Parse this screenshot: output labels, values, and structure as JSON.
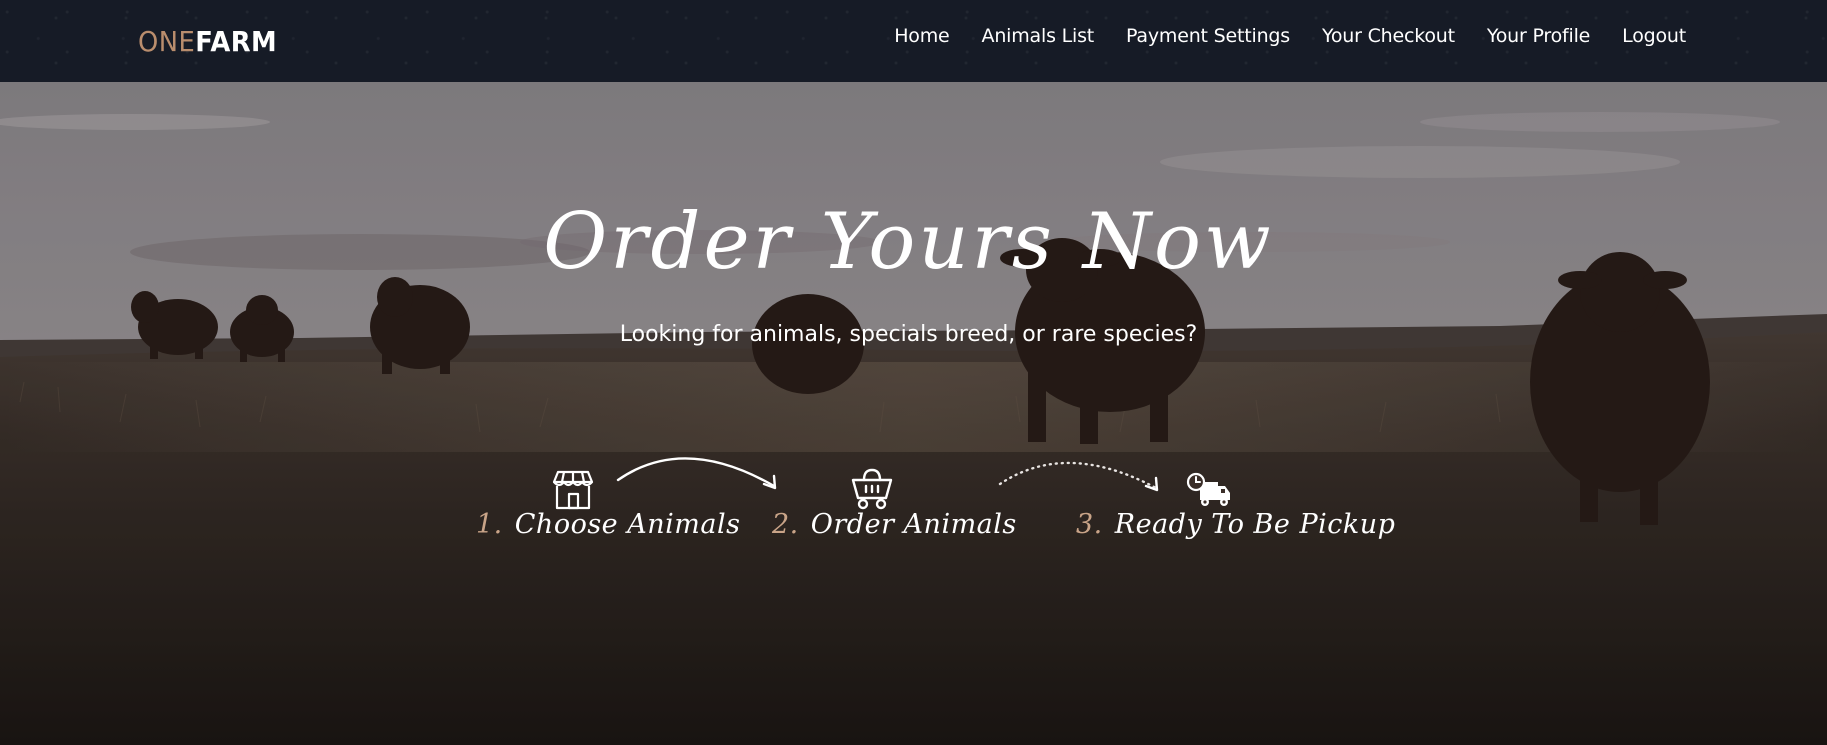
{
  "header": {
    "logo_part1": "ONE",
    "logo_part2": "FARM",
    "nav": [
      "Home",
      "Animals List",
      "Payment Settings",
      "Your Checkout",
      "Your Profile",
      "Logout"
    ]
  },
  "hero": {
    "title": "Order Yours Now",
    "subtitle": "Looking for animals, specials breed, or rare species?",
    "steps": [
      {
        "number": "1.",
        "label": "Choose Animals",
        "icon": "shop-icon"
      },
      {
        "number": "2.",
        "label": "Order Animals",
        "icon": "cart-icon"
      },
      {
        "number": "3.",
        "label": "Ready To Be Pickup",
        "icon": "delivery-truck-icon"
      }
    ]
  },
  "colors": {
    "navbar": "#161b26",
    "logo_accent": "#b98d6d",
    "step_number": "#c9a488",
    "text": "#ffffff"
  }
}
